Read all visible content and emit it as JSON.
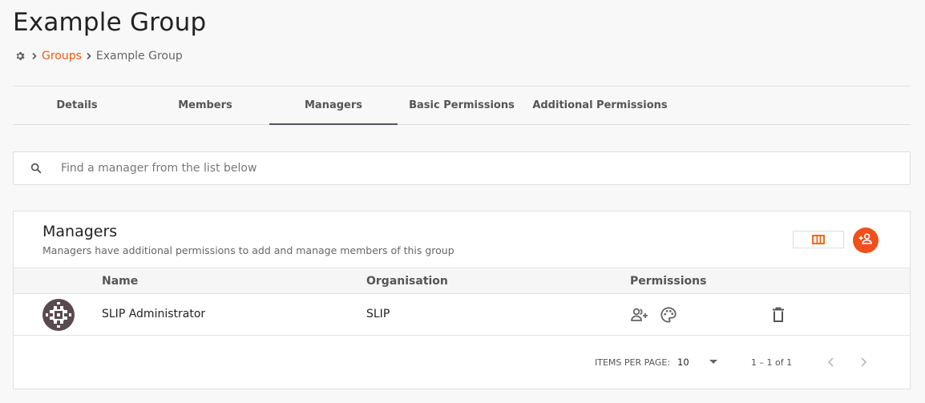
{
  "page": {
    "title": "Example Group"
  },
  "breadcrumb": {
    "home_icon": "gear-icon",
    "items": [
      {
        "label": "Groups",
        "link": true
      },
      {
        "label": "Example Group",
        "link": false
      }
    ]
  },
  "tabs": [
    {
      "label": "Details",
      "active": false
    },
    {
      "label": "Members",
      "active": false
    },
    {
      "label": "Managers",
      "active": true
    },
    {
      "label": "Basic Permissions",
      "active": false
    },
    {
      "label": "Additional Permissions",
      "active": false
    }
  ],
  "search": {
    "placeholder": "Find a manager from the list below",
    "value": "",
    "icon": "search-icon"
  },
  "managers_card": {
    "title": "Managers",
    "subtitle": "Managers have additional permissions to add and manage members of this group",
    "columns_button_icon": "view-columns-icon",
    "add_button_icon": "add-person-icon",
    "table": {
      "headers": [
        "Name",
        "Organisation",
        "Permissions"
      ],
      "rows": [
        {
          "name": "SLIP Administrator",
          "organisation": "SLIP",
          "permission_icons": [
            "group-add-icon",
            "palette-icon"
          ],
          "action_icon": "delete-icon"
        }
      ]
    },
    "paginator": {
      "items_per_page_label": "ITEMS PER PAGE:",
      "items_per_page": "10",
      "range": "1 – 1 of 1"
    }
  },
  "colors": {
    "accent": "#ee5a14",
    "add_button": "#f0501a",
    "active_tab_underline": "#55536a"
  }
}
